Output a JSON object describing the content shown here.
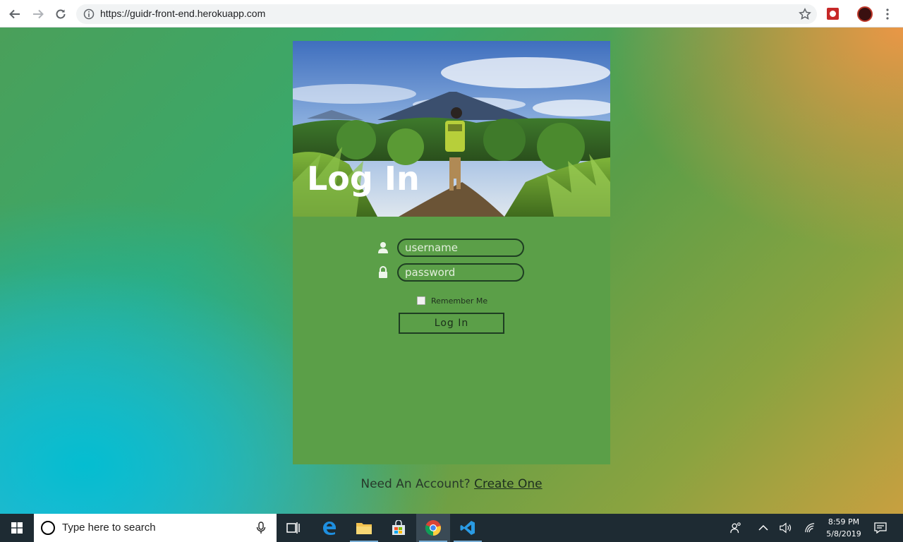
{
  "browser": {
    "url": "https://guidr-front-end.herokuapp.com",
    "icons": {
      "back": "arrow-left-icon",
      "forward": "arrow-right-icon",
      "reload": "reload-icon",
      "site_info": "info-icon",
      "bookmark": "star-icon",
      "menu": "more-vert-icon"
    }
  },
  "login_card": {
    "title": "Log In",
    "username_placeholder": "username",
    "password_placeholder": "password",
    "remember_label": "Remember Me",
    "remember_checked": false,
    "submit_label": "Log In",
    "card_color": "#5b9f48"
  },
  "signup": {
    "prompt": "Need An Account?",
    "link_label": "Create One"
  },
  "taskbar": {
    "search_placeholder": "Type here to search",
    "time": "8:59 PM",
    "date": "5/8/2019",
    "apps": [
      "task-view",
      "edge",
      "file-explorer",
      "store",
      "chrome",
      "vscode"
    ]
  }
}
